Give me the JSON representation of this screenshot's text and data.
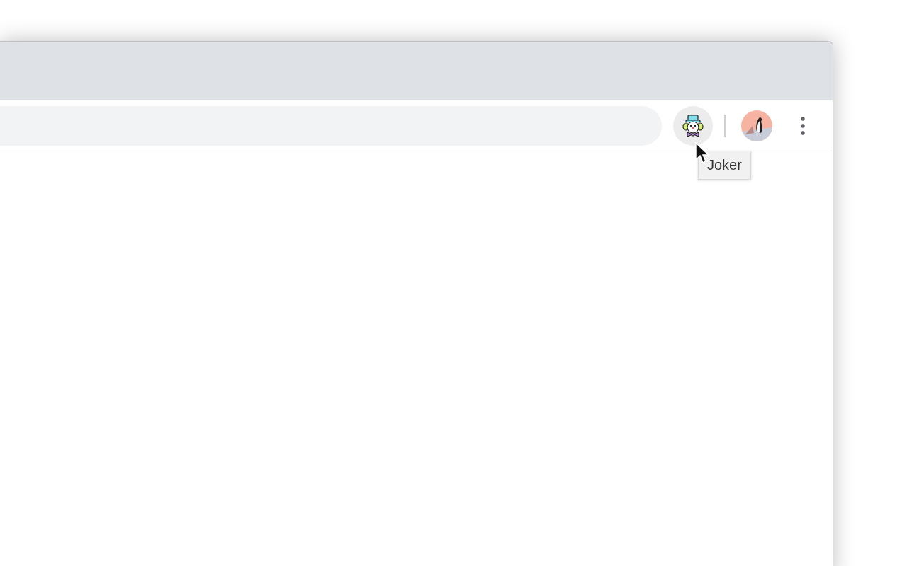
{
  "toolbar": {
    "extension_button": {
      "hovered": true
    },
    "tooltip": "Joker"
  }
}
